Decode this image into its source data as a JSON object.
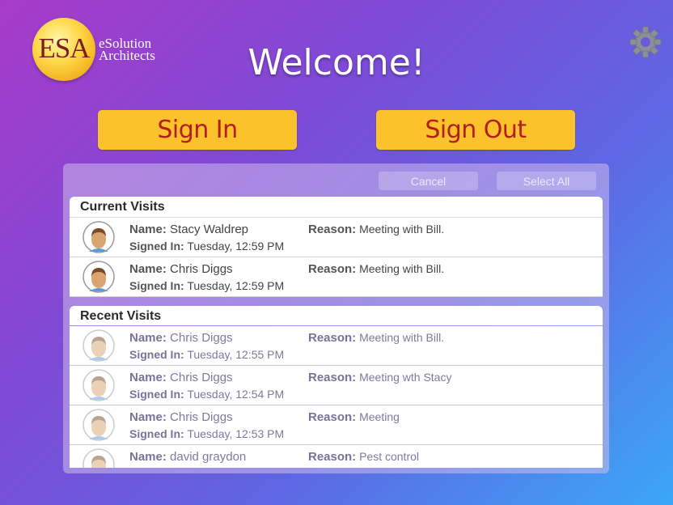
{
  "logo": {
    "mark": "ESA",
    "line1": "eSolution",
    "line2": "Architects"
  },
  "title": "Welcome!",
  "buttons": {
    "sign_in": "Sign In",
    "sign_out": "Sign Out"
  },
  "toolbar": {
    "cancel": "Cancel",
    "select_all": "Select All"
  },
  "labels": {
    "name": "Name:",
    "signed_in": "Signed In:",
    "reason": "Reason:"
  },
  "current_visits": {
    "header": "Current Visits",
    "rows": [
      {
        "name": "Stacy Waldrep",
        "signed_in": "Tuesday, 12:59 PM",
        "reason": "Meeting with Bill."
      },
      {
        "name": "Chris Diggs",
        "signed_in": "Tuesday, 12:59 PM",
        "reason": "Meeting with Bill."
      }
    ]
  },
  "recent_visits": {
    "header": "Recent Visits",
    "rows": [
      {
        "name": "Chris Diggs",
        "signed_in": "Tuesday, 12:55 PM",
        "reason": "Meeting with Bill."
      },
      {
        "name": "Chris Diggs",
        "signed_in": "Tuesday, 12:54 PM",
        "reason": "Meeting wth Stacy"
      },
      {
        "name": "Chris Diggs",
        "signed_in": "Tuesday, 12:53 PM",
        "reason": "Meeting"
      },
      {
        "name": "david graydon",
        "signed_in": "",
        "reason": "Pest control"
      }
    ]
  },
  "colors": {
    "button_bg": "#fcc22b",
    "button_text": "#b41d1d"
  },
  "icons": {
    "settings": "gear-icon",
    "avatar": "person-avatar-icon"
  }
}
